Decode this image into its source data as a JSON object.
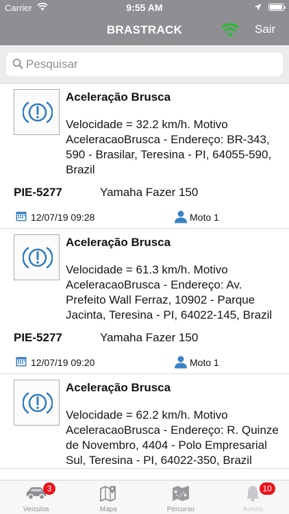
{
  "status_bar": {
    "carrier": "Carrier",
    "time": "9:55 AM",
    "battery_level": 0.95
  },
  "nav": {
    "title": "BRASTRACK",
    "logout_label": "Sair",
    "wifi_color": "#22c22e"
  },
  "search": {
    "placeholder": "Pesquisar",
    "value": ""
  },
  "alerts": [
    {
      "title": "Aceleração Brusca",
      "description": "Velocidade = 32.2 km/h. Motivo AceleracaoBrusca - Endereço: BR-343, 590 - Brasilar, Teresina - PI, 64055-590, Brazil",
      "plate": "PIE-5277",
      "model": "Yamaha  Fazer 150",
      "datetime": "12/07/19 09:28",
      "driver": "Moto 1"
    },
    {
      "title": "Aceleração Brusca",
      "description": "Velocidade = 61.3 km/h. Motivo AceleracaoBrusca - Endereço: Av. Prefeito Wall Ferraz, 10902 - Parque Jacinta, Teresina - PI, 64022-145, Brazil",
      "plate": "PIE-5277",
      "model": "Yamaha  Fazer 150",
      "datetime": "12/07/19 09:20",
      "driver": "Moto 1"
    },
    {
      "title": "Aceleração Brusca",
      "description": "Velocidade = 62.2 km/h. Motivo AceleracaoBrusca - Endereço: R. Quinze de Novembro, 4404 - Polo Empresarial Sul, Teresina - PI, 64022-350, Brazil",
      "plate": "",
      "model": "",
      "datetime": "",
      "driver": ""
    }
  ],
  "tabs": [
    {
      "label": "Veículos",
      "icon": "car-icon",
      "badge": "3"
    },
    {
      "label": "Mapa",
      "icon": "map-icon",
      "badge": ""
    },
    {
      "label": "Percurso",
      "icon": "route-map-icon",
      "badge": ""
    },
    {
      "label": "Avisos",
      "icon": "bell-icon",
      "badge": "10"
    }
  ],
  "colors": {
    "bar": "#8e8e93",
    "alert_icon": "#2f7bc4",
    "badge": "#e8141a",
    "meta_icon": "#3b82c4"
  }
}
